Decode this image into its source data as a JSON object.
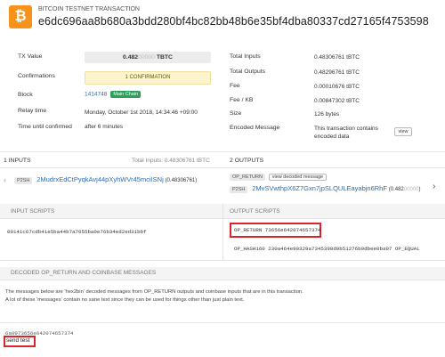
{
  "header": {
    "logo_glyph": "₿",
    "subtitle": "BITCOIN TESTNET TRANSACTION",
    "hash": "e6dc696aa8b680a3bdd280bf4bc82bb48b6e35bf4dba80337cd27165f4753598"
  },
  "left_info": {
    "tx_value_label": "TX Value",
    "tx_value": "0.482",
    "tx_value_faded": "00000",
    "tx_value_unit": "TBTC",
    "confirmations_label": "Confirmations",
    "confirmations_value": "1 CONFIRMATION",
    "block_label": "Block",
    "block_value": "1414748",
    "block_badge": "Main Chain",
    "relay_label": "Relay time",
    "relay_value": "Monday, October 1st 2018, 14:34:46 +09:00",
    "time_confirmed_label": "Time until confirmed",
    "time_confirmed_value": "after 6 minutes"
  },
  "right_info": {
    "total_inputs_label": "Total Inputs",
    "total_inputs_value": "0.48306761",
    "total_outputs_label": "Total Outputs",
    "total_outputs_value": "0.48296761",
    "fee_label": "Fee",
    "fee_value": "0.00010676",
    "fee_kb_label": "Fee / KB",
    "fee_kb_value": "0.00847302",
    "size_label": "Size",
    "size_value": "126 bytes",
    "encoded_label": "Encoded Message",
    "encoded_value": "This transaction contains encoded data",
    "view_button": "view",
    "unit": "tBTC"
  },
  "inputs": {
    "title": "1 INPUTS",
    "total": "Total Inputs: 0.48306761 tBTC",
    "items": [
      {
        "type": "P2SH",
        "address": "2MudrxEdCtPyqkAvj44pXyhWVr45mciISNj",
        "amount": "(0.48306761)"
      }
    ]
  },
  "outputs": {
    "title": "2 OUTPUTS",
    "items": [
      {
        "type": "OP_RETURN",
        "action": "view decoded message"
      },
      {
        "type": "P2SH",
        "address": "2MvSVwthpX6Z7Gxn7jpSLQULEayabjn6RhF",
        "amount": "(0.482",
        "amount_faded": "00000",
        "amount_close": ")"
      }
    ]
  },
  "scripts": {
    "input_title": "INPUT SCRIPTS",
    "output_title": "OUTPUT SCRIPTS",
    "input_script": "00141c67cdb41e5ba44b7a7055ba0e76b34ed2ed31bbf",
    "output_script_1": "OP_RETURN 73656e642074657374",
    "output_script_2": "OP_HASH160 230a464e90329a7345398d9b51276b9dbee0ba97 OP_EQUAL"
  },
  "decoded": {
    "title": "DECODED OP_RETURN AND COINBASE MESSAGES",
    "desc1": "The messages below are 'hex2bin' decoded messages from OP_RETURN outputs and coinbase inputs that are in this transaction.",
    "desc2": "A lot of these 'messages' contain no sane text since they can be used for things other than just plain text.",
    "hex": "6a0973656e642074657374",
    "text": "send test"
  }
}
